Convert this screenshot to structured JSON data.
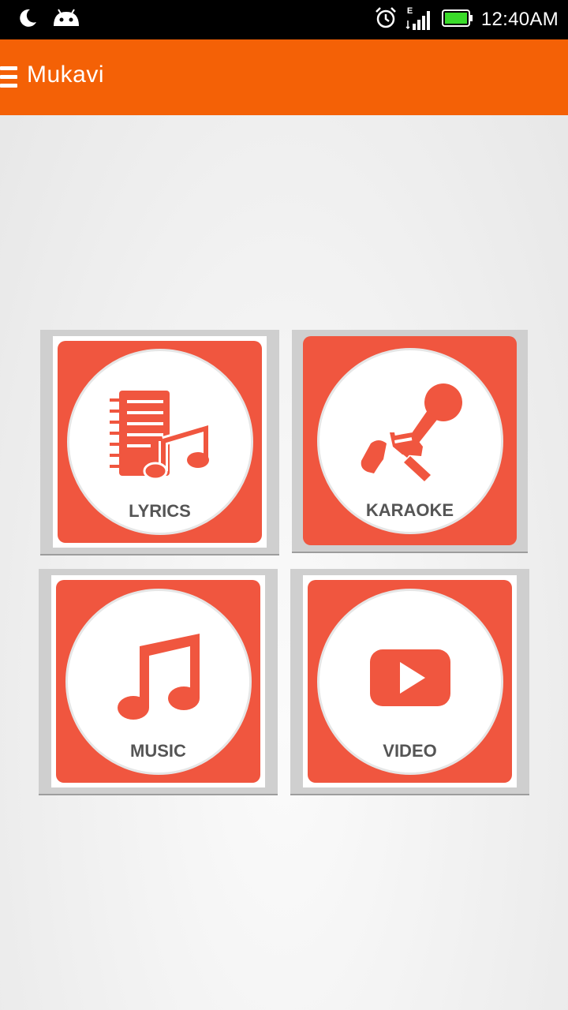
{
  "status_bar": {
    "time": "12:40AM",
    "network_type": "E",
    "icons": [
      "moon-icon",
      "android-icon",
      "alarm-icon",
      "signal-icon",
      "battery-icon"
    ]
  },
  "action_bar": {
    "title": "Mukavi",
    "menu_icon": "hamburger-menu-icon",
    "background": "#f46106"
  },
  "tiles": [
    {
      "label": "LYRICS",
      "icon": "lyrics-notebook-music-icon"
    },
    {
      "label": "KARAOKE",
      "icon": "microphone-icon"
    },
    {
      "label": "MUSIC",
      "icon": "music-note-icon"
    },
    {
      "label": "VIDEO",
      "icon": "video-play-icon"
    }
  ],
  "colors": {
    "accent": "#f0563f",
    "label": "#555555"
  }
}
